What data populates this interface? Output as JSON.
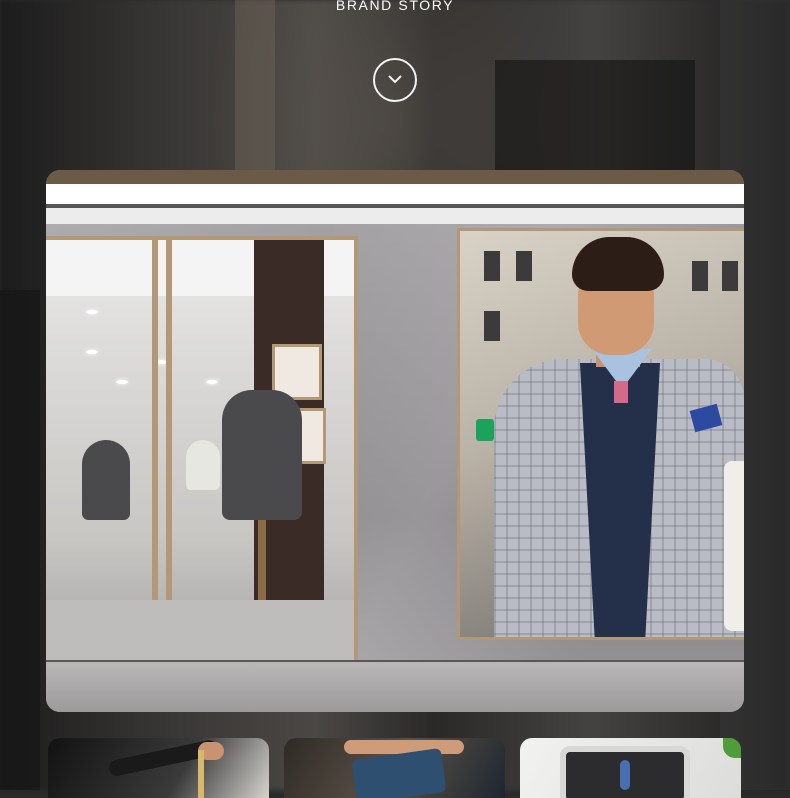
{
  "header": {
    "title": "BRAND STORY"
  },
  "scroll_button": {
    "icon": "chevron-down-icon"
  },
  "hero": {
    "description": ""
  },
  "thumbnails": [
    {
      "icon": "tailor-measuring-image"
    },
    {
      "icon": "leather-wallet-image"
    },
    {
      "icon": "tablet-display-image"
    }
  ]
}
